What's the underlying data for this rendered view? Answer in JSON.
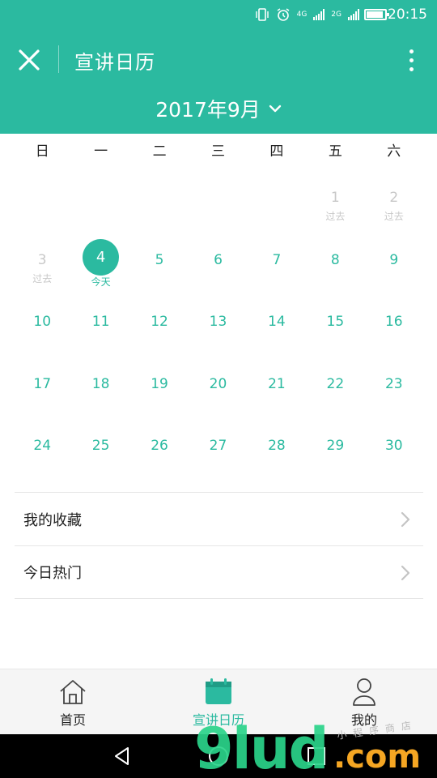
{
  "status_bar": {
    "time": "20:15",
    "network_1": "4G",
    "network_2": "2G",
    "battery_level": 0.9,
    "icons": [
      "vibrate-icon",
      "alarm-icon",
      "signal-icon",
      "signal-icon",
      "battery-icon"
    ]
  },
  "header": {
    "title": "宣讲日历",
    "month_label": "2017年9月",
    "accent_color": "#2bbaa0"
  },
  "calendar": {
    "weekdays": [
      "日",
      "一",
      "二",
      "三",
      "四",
      "五",
      "六"
    ],
    "leading_blank_days": 5,
    "days": [
      {
        "num": "1",
        "sub": "过去",
        "state": "past"
      },
      {
        "num": "2",
        "sub": "过去",
        "state": "past"
      },
      {
        "num": "3",
        "sub": "过去",
        "state": "past"
      },
      {
        "num": "4",
        "sub": "今天",
        "state": "today"
      },
      {
        "num": "5",
        "sub": "",
        "state": "future"
      },
      {
        "num": "6",
        "sub": "",
        "state": "future"
      },
      {
        "num": "7",
        "sub": "",
        "state": "future"
      },
      {
        "num": "8",
        "sub": "",
        "state": "future"
      },
      {
        "num": "9",
        "sub": "",
        "state": "future"
      },
      {
        "num": "10",
        "sub": "",
        "state": "future"
      },
      {
        "num": "11",
        "sub": "",
        "state": "future"
      },
      {
        "num": "12",
        "sub": "",
        "state": "future"
      },
      {
        "num": "13",
        "sub": "",
        "state": "future"
      },
      {
        "num": "14",
        "sub": "",
        "state": "future"
      },
      {
        "num": "15",
        "sub": "",
        "state": "future"
      },
      {
        "num": "16",
        "sub": "",
        "state": "future"
      },
      {
        "num": "17",
        "sub": "",
        "state": "future"
      },
      {
        "num": "18",
        "sub": "",
        "state": "future"
      },
      {
        "num": "19",
        "sub": "",
        "state": "future"
      },
      {
        "num": "20",
        "sub": "",
        "state": "future"
      },
      {
        "num": "21",
        "sub": "",
        "state": "future"
      },
      {
        "num": "22",
        "sub": "",
        "state": "future"
      },
      {
        "num": "23",
        "sub": "",
        "state": "future"
      },
      {
        "num": "24",
        "sub": "",
        "state": "future"
      },
      {
        "num": "25",
        "sub": "",
        "state": "future"
      },
      {
        "num": "26",
        "sub": "",
        "state": "future"
      },
      {
        "num": "27",
        "sub": "",
        "state": "future"
      },
      {
        "num": "28",
        "sub": "",
        "state": "future"
      },
      {
        "num": "29",
        "sub": "",
        "state": "future"
      },
      {
        "num": "30",
        "sub": "",
        "state": "future"
      }
    ]
  },
  "menu": {
    "favorites_label": "我的收藏",
    "hot_today_label": "今日热门"
  },
  "tabbar": {
    "home_label": "首页",
    "calendar_label": "宣讲日历",
    "mine_label": "我的"
  },
  "watermark": {
    "main": "9lud",
    "suffix": ".com",
    "small": "小程序商店"
  }
}
